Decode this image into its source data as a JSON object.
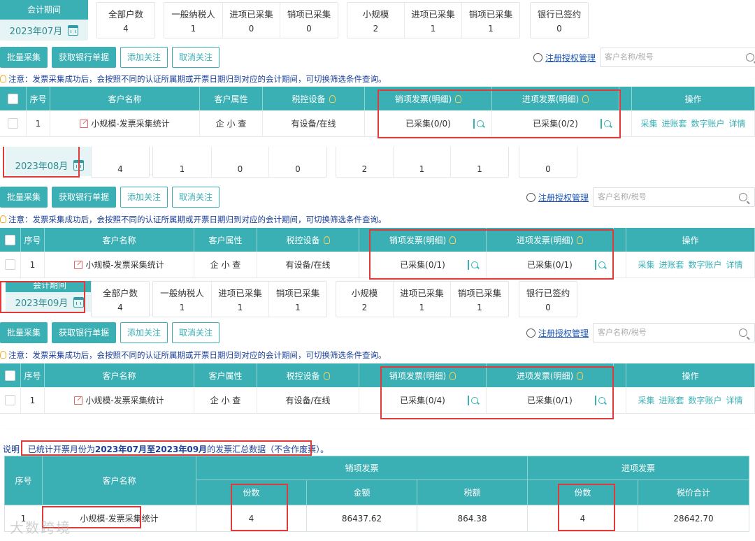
{
  "common": {
    "period_label": "会计期间",
    "stats_labels": [
      "全部户数",
      "一般纳税人",
      "进项已采集",
      "销项已采集",
      "小规模",
      "进项已采集",
      "销项已采集",
      "银行已签约"
    ],
    "buttons": [
      "批量采集",
      "获取银行单据",
      "添加关注",
      "取消关注"
    ],
    "register_link": "注册授权管理",
    "search_placeholder": "客户名称/税号",
    "notice": "注意：发票采集成功后，会按照不同的认证所属期或开票日期归到对应的会计期间，可切换筛选条件查询。",
    "columns": [
      "序号",
      "客户名称",
      "客户属性",
      "税控设备",
      "销项发票(明细)",
      "进项发票(明细)",
      "操作"
    ],
    "row": {
      "index": "1",
      "customer": "小规模-发票采集统计",
      "attribute": "企 小 查",
      "device": "有设备/在线",
      "ops": [
        "采集",
        "进账套",
        "数字账户",
        "详情"
      ]
    }
  },
  "periods": [
    {
      "date": "2023年07月",
      "stats": [
        "4",
        "1",
        "0",
        "0",
        "2",
        "1",
        "1",
        "0"
      ],
      "sales_status": "已采集(0/0)",
      "purchase_status": "已采集(0/2)"
    },
    {
      "date": "2023年08月",
      "stats": [
        "4",
        "1",
        "0",
        "0",
        "2",
        "1",
        "1",
        "0"
      ],
      "sales_status": "已采集(0/1)",
      "purchase_status": "已采集(0/1)"
    },
    {
      "date": "2023年09月",
      "stats": [
        "4",
        "1",
        "1",
        "1",
        "2",
        "1",
        "1",
        "0"
      ],
      "sales_status": "已采集(0/4)",
      "purchase_status": "已采集(0/1)"
    }
  ],
  "summary": {
    "note_prefix": "说明",
    "note_pre": "已统计开票月份为",
    "note_range": "2023年07月至2023年09月",
    "note_post": "的发票汇总数据（不含作废票）。",
    "headers": {
      "index": "序号",
      "customer": "客户名称",
      "sales_group": "销项发票",
      "purchase_group": "进项发票",
      "sales_count": "份数",
      "sales_amount": "金额",
      "sales_tax": "税额",
      "purchase_count": "份数",
      "purchase_total": "税价合计"
    },
    "row": {
      "index": "1",
      "customer": "小规模-发票采集统计",
      "sales_count": "4",
      "sales_amount": "86437.62",
      "sales_tax": "864.38",
      "purchase_count": "4",
      "purchase_total": "28642.70"
    },
    "watermark": "大数跨境"
  }
}
